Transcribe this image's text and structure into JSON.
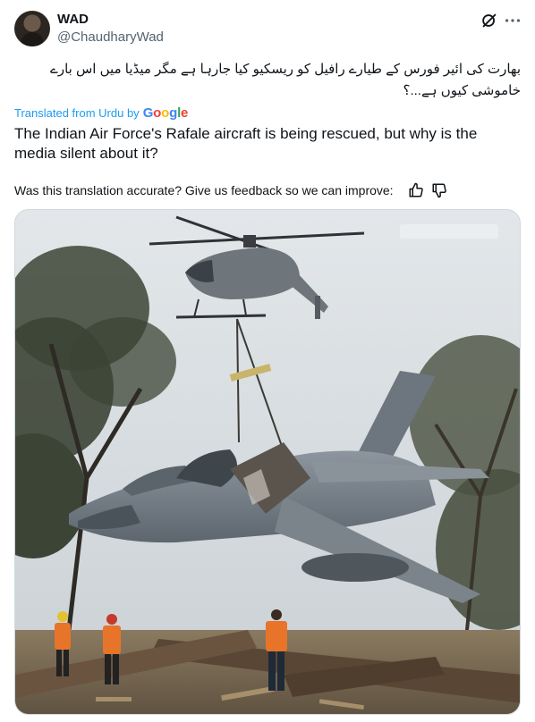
{
  "author": {
    "display_name": "WAD",
    "handle": "@ChaudharyWad",
    "avatar_icon": "avatar-photo"
  },
  "header_icons": {
    "grok": "grok-icon",
    "more": "more-icon"
  },
  "post": {
    "original_text": "بھارت کی ائیر فورس کے طیارے رافیل کو ریسکیو کیا جارہا ہے مگر میڈیا میں اس بارے خاموشی کیوں ہے...؟",
    "translated_from": "Translated from Urdu by",
    "translator_brand": "Google",
    "translation": "The Indian Air Force's Rafale aircraft is being rescued, but why is the media silent about it?",
    "feedback_prompt": "Was this translation accurate? Give us feedback so we can improve:"
  },
  "media": {
    "kind": "photo",
    "icons": [
      "thumbs-up-icon",
      "thumbs-down-icon"
    ]
  },
  "colors": {
    "link_blue": "#1d9bf0",
    "secondary_text": "#536471",
    "border": "#cfd9de"
  }
}
